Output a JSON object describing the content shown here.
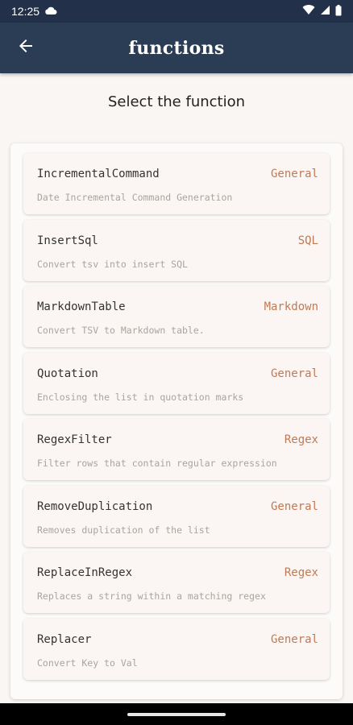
{
  "status": {
    "time": "12:25"
  },
  "header": {
    "title": "functions"
  },
  "page": {
    "subtitle": "Select the function"
  },
  "colors": {
    "app_bar": "#2b3d55",
    "status_bar": "#223049",
    "category": "#c07a55"
  },
  "functions": [
    {
      "name": "IncrementalCommand",
      "category": "General",
      "description": "Date Incremental Command Generation"
    },
    {
      "name": "InsertSql",
      "category": "SQL",
      "description": "Convert tsv into insert SQL"
    },
    {
      "name": "MarkdownTable",
      "category": "Markdown",
      "description": "Convert TSV to Markdown table."
    },
    {
      "name": "Quotation",
      "category": "General",
      "description": "Enclosing the list in quotation marks"
    },
    {
      "name": "RegexFilter",
      "category": "Regex",
      "description": "Filter rows that contain regular expression"
    },
    {
      "name": "RemoveDuplication",
      "category": "General",
      "description": "Removes duplication of the list"
    },
    {
      "name": "ReplaceInRegex",
      "category": "Regex",
      "description": "Replaces a string within a matching regex"
    },
    {
      "name": "Replacer",
      "category": "General",
      "description": "Convert Key to Val"
    }
  ]
}
